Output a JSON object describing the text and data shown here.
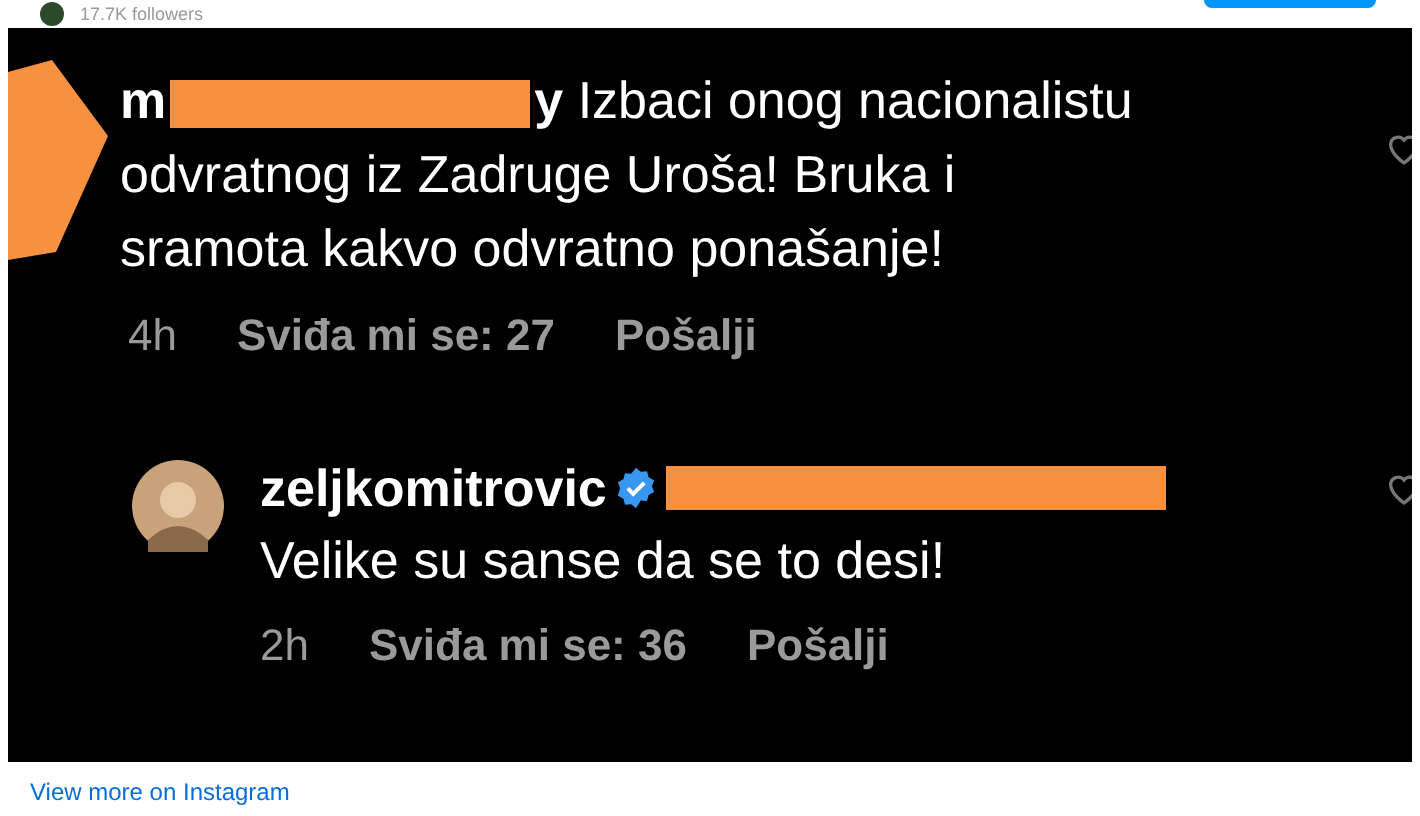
{
  "header": {
    "followers": "17.7K followers"
  },
  "comments": [
    {
      "kind": "comment",
      "username_start": "m",
      "username_end": "y",
      "text": "Izbaci onog nacionalistu odvratnog iz Zadruge Uroša! Bruka i sramota kakvo odvratno ponašanje!",
      "time": "4h",
      "likes": "Sviđa mi se: 27",
      "reply": "Pošalji"
    },
    {
      "kind": "reply",
      "username": "zeljkomitrovic",
      "text": "Velike su sanse da se to desi!",
      "time": "2h",
      "likes": "Sviđa mi se: 36",
      "reply": "Pošalji",
      "verified": true
    }
  ],
  "footer": {
    "link": "View more on Instagram"
  }
}
